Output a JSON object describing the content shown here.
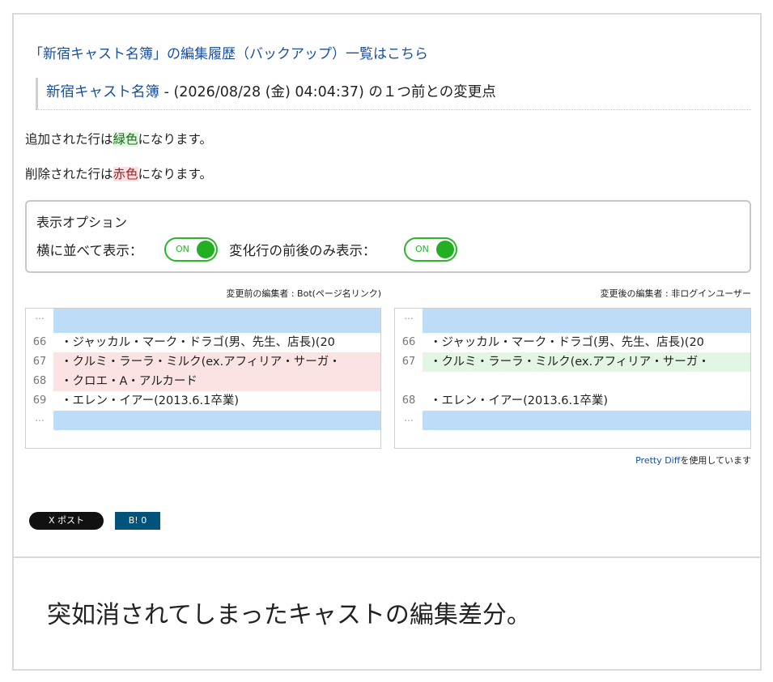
{
  "header": {
    "history_link": "「新宿キャスト名簿」の編集履歴（バックアップ）一覧はこちら",
    "page_link": "新宿キャスト名簿",
    "title_rest": " - (2026/08/28 (金) 04:04:37) の１つ前との変更点"
  },
  "notes": {
    "added_prefix": "追加された行は",
    "added_color_word": "緑色",
    "added_suffix": "になります。",
    "removed_prefix": "削除された行は",
    "removed_color_word": "赤色",
    "removed_suffix": "になります。"
  },
  "options": {
    "title": "表示オプション",
    "side_by_side_label": "横に並べて表示：",
    "side_by_side_state": "ON",
    "changed_only_label": "変化行の前後のみ表示：",
    "changed_only_state": "ON"
  },
  "diff": {
    "before_editor": "変更前の編集者 : Bot(ページ名リンク)",
    "after_editor": "変更後の編集者 : 非ログインユーザー",
    "before_rows": [
      {
        "num": "...",
        "text": "",
        "type": "skip"
      },
      {
        "num": "66",
        "text": "・ジャッカル・マーク・ドラゴ(男、先生、店長)(20",
        "type": "same"
      },
      {
        "num": "67",
        "text": "・クルミ・ラーラ・ミルク(ex.アフィリア・サーガ・",
        "type": "del"
      },
      {
        "num": "68",
        "text": "・クロエ・A・アルカード",
        "type": "del"
      },
      {
        "num": "69",
        "text": "・エレン・イアー(2013.6.1卒業)",
        "type": "same"
      },
      {
        "num": "...",
        "text": "",
        "type": "skip"
      }
    ],
    "after_rows": [
      {
        "num": "...",
        "text": "",
        "type": "skip"
      },
      {
        "num": "66",
        "text": "・ジャッカル・マーク・ドラゴ(男、先生、店長)(20",
        "type": "same"
      },
      {
        "num": "67",
        "text": "・クルミ・ラーラ・ミルク(ex.アフィリア・サーガ・",
        "type": "ins"
      },
      {
        "num": "",
        "text": "",
        "type": "empty"
      },
      {
        "num": "68",
        "text": "・エレン・イアー(2013.6.1卒業)",
        "type": "same"
      },
      {
        "num": "...",
        "text": "",
        "type": "skip"
      }
    ],
    "credit_link": "Pretty Diff",
    "credit_suffix": "を使用しています"
  },
  "share": {
    "x_post": "X ポスト",
    "hatena": "B! 0"
  },
  "caption": "突如消されてしまったキャストの編集差分。",
  "colors": {
    "link": "#1a4fa0",
    "toggle_on": "#22b022",
    "added_bg": "#e2f6e3",
    "removed_bg": "#fbe3e3",
    "skip_bg": "#bddcf8"
  }
}
